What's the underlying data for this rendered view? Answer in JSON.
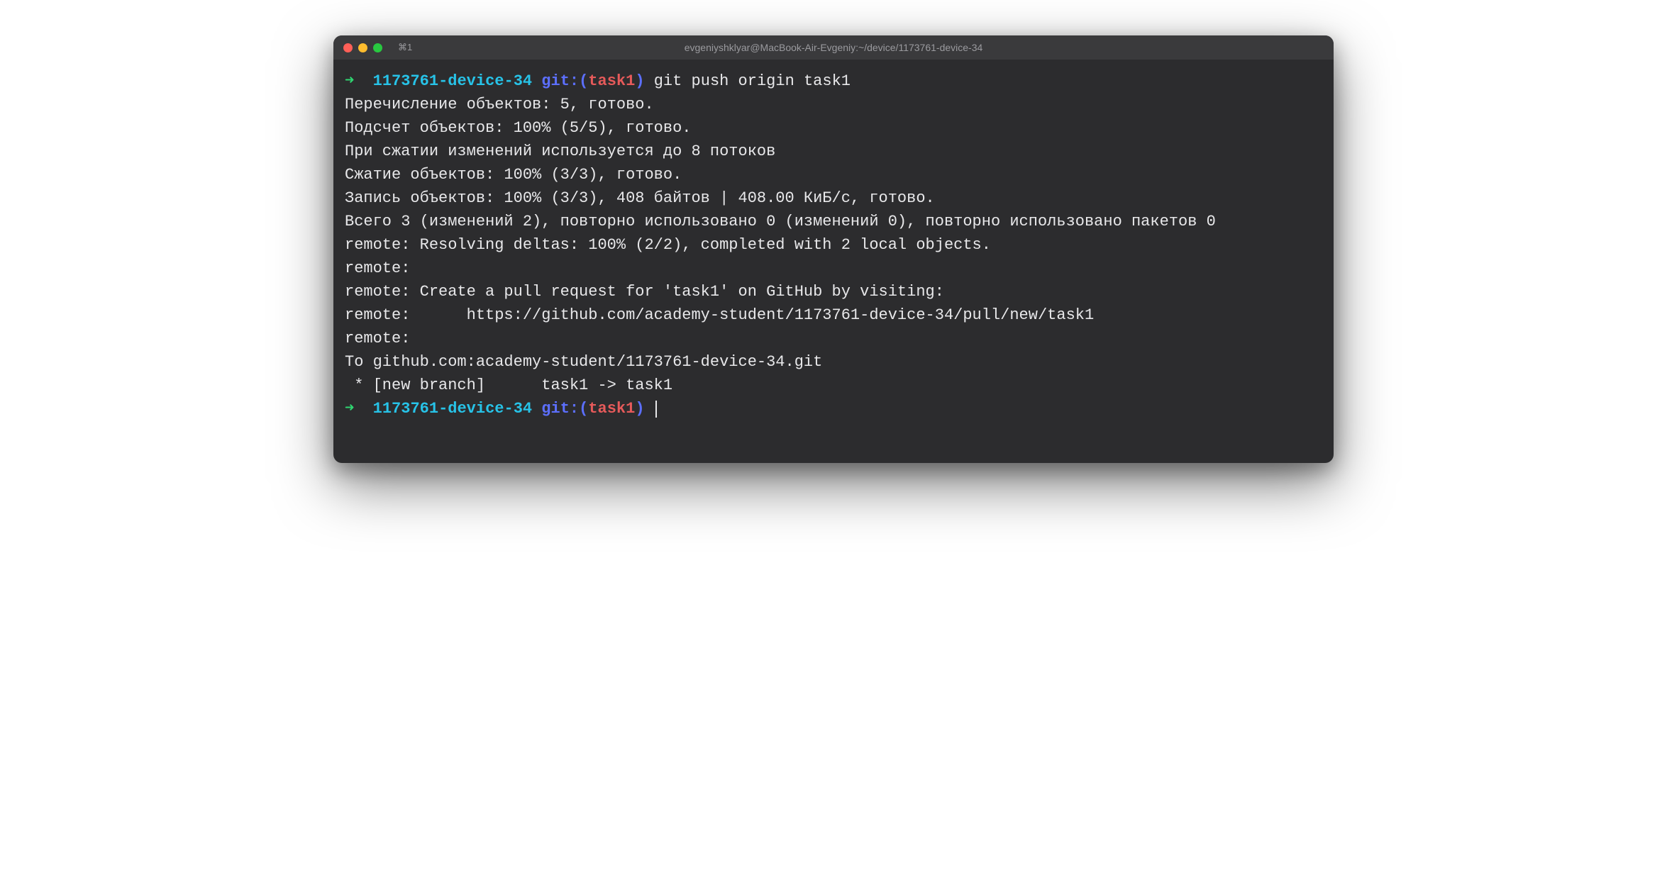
{
  "titlebar": {
    "tab_label": "⌘1",
    "window_title": "evgeniyshklyar@MacBook-Air-Evgeniy:~/device/1173761-device-34"
  },
  "prompt1": {
    "arrow": "➜",
    "dir": "1173761-device-34",
    "git_label": "git:",
    "paren_open": "(",
    "branch": "task1",
    "paren_close": ")",
    "command": "git push origin task1"
  },
  "output": {
    "l1": "Перечисление объектов: 5, готово.",
    "l2": "Подсчет объектов: 100% (5/5), готово.",
    "l3": "При сжатии изменений используется до 8 потоков",
    "l4": "Сжатие объектов: 100% (3/3), готово.",
    "l5": "Запись объектов: 100% (3/3), 408 байтов | 408.00 КиБ/с, готово.",
    "l6": "Всего 3 (изменений 2), повторно использовано 0 (изменений 0), повторно использовано пакетов 0",
    "l7": "remote: Resolving deltas: 100% (2/2), completed with 2 local objects.",
    "l8": "remote:",
    "l9": "remote: Create a pull request for 'task1' on GitHub by visiting:",
    "l10": "remote:      https://github.com/academy-student/1173761-device-34/pull/new/task1",
    "l11": "remote:",
    "l12": "To github.com:academy-student/1173761-device-34.git",
    "l13": " * [new branch]      task1 -> task1"
  },
  "prompt2": {
    "arrow": "➜",
    "dir": "1173761-device-34",
    "git_label": "git:",
    "paren_open": "(",
    "branch": "task1",
    "paren_close": ")"
  }
}
